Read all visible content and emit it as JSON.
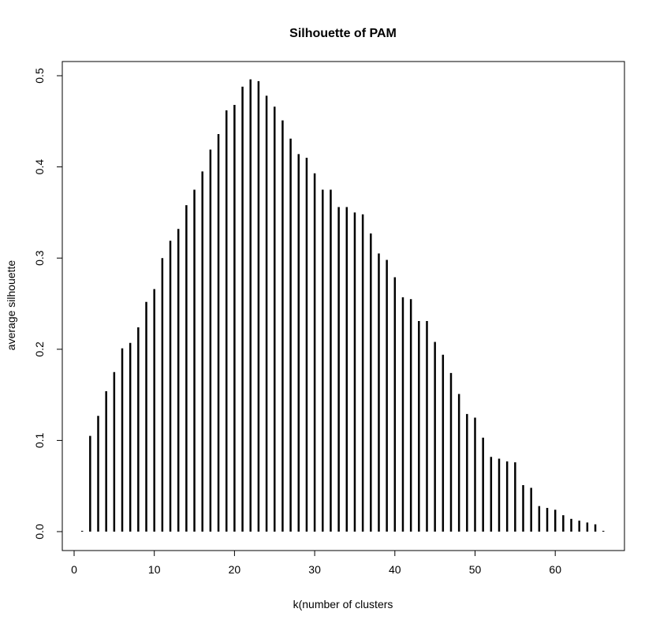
{
  "chart_data": {
    "type": "bar",
    "style": "histogram-like vertical lines (type h)",
    "title": "Silhouette of PAM",
    "xlabel": "k(number of clusters",
    "ylabel": "average silhouette",
    "xlim": [
      -0.6,
      67.6
    ],
    "ylim": [
      -0.02,
      0.51
    ],
    "xticks": [
      0,
      10,
      20,
      30,
      40,
      50,
      60
    ],
    "yticks": [
      0.0,
      0.1,
      0.2,
      0.3,
      0.4,
      0.5
    ],
    "ytick_labels": [
      "0.0",
      "0.1",
      "0.2",
      "0.3",
      "0.4",
      "0.5"
    ],
    "grid": false,
    "color": "#000000",
    "x": [
      1,
      2,
      3,
      4,
      5,
      6,
      7,
      8,
      9,
      10,
      11,
      12,
      13,
      14,
      15,
      16,
      17,
      18,
      19,
      20,
      21,
      22,
      23,
      24,
      25,
      26,
      27,
      28,
      29,
      30,
      31,
      32,
      33,
      34,
      35,
      36,
      37,
      38,
      39,
      40,
      41,
      42,
      43,
      44,
      45,
      46,
      47,
      48,
      49,
      50,
      51,
      52,
      53,
      54,
      55,
      56,
      57,
      58,
      59,
      60,
      61,
      62,
      63,
      64,
      65,
      66
    ],
    "values": [
      0,
      0.105,
      0.127,
      0.154,
      0.175,
      0.201,
      0.207,
      0.224,
      0.252,
      0.266,
      0.3,
      0.319,
      0.332,
      0.358,
      0.375,
      0.395,
      0.419,
      0.436,
      0.462,
      0.468,
      0.488,
      0.496,
      0.494,
      0.478,
      0.466,
      0.451,
      0.431,
      0.414,
      0.41,
      0.393,
      0.375,
      0.375,
      0.356,
      0.356,
      0.35,
      0.348,
      0.327,
      0.305,
      0.298,
      0.279,
      0.257,
      0.255,
      0.231,
      0.231,
      0.208,
      0.194,
      0.174,
      0.151,
      0.129,
      0.125,
      0.103,
      0.082,
      0.08,
      0.077,
      0.076,
      0.051,
      0.048,
      0.028,
      0.026,
      0.024,
      0.018,
      0.014,
      0.012,
      0.01,
      0.008,
      0
    ]
  }
}
